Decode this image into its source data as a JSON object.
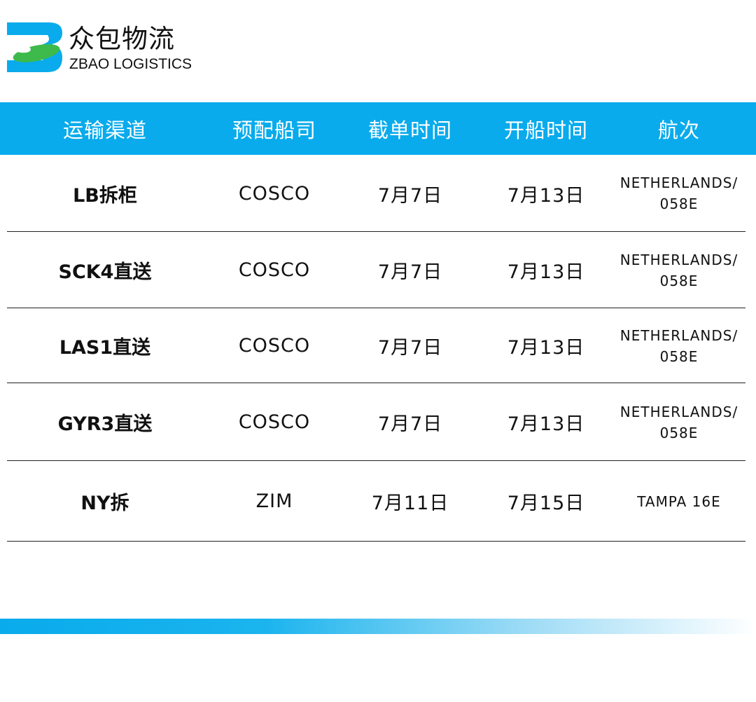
{
  "brand": {
    "name_cn": "众包物流",
    "name_en": "ZBAO LOGISTICS",
    "colors": {
      "blue": "#09abec",
      "green": "#3dba4b"
    }
  },
  "table": {
    "header_color": "#09abec",
    "headers": [
      "运输渠道",
      "预配船司",
      "截单时间",
      "开船时间",
      "航次"
    ],
    "rows": [
      {
        "channel": "LB拆柜",
        "carrier": "COSCO",
        "cutoff": "7月7日",
        "departure": "7月13日",
        "voyage": [
          "NETHERLANDS/",
          "058E"
        ]
      },
      {
        "channel": "SCK4直送",
        "carrier": "COSCO",
        "cutoff": "7月7日",
        "departure": "7月13日",
        "voyage": [
          "NETHERLANDS/",
          "058E"
        ]
      },
      {
        "channel": "LAS1直送",
        "carrier": "COSCO",
        "cutoff": "7月7日",
        "departure": "7月13日",
        "voyage": [
          "NETHERLANDS/",
          "058E"
        ]
      },
      {
        "channel": "GYR3直送",
        "carrier": "COSCO",
        "cutoff": "7月7日",
        "departure": "7月13日",
        "voyage": [
          "NETHERLANDS/",
          "058E"
        ]
      },
      {
        "channel": "NY拆",
        "carrier": "ZIM",
        "cutoff": "7月11日",
        "departure": "7月15日",
        "voyage": [
          "TAMPA 16E"
        ]
      }
    ]
  }
}
